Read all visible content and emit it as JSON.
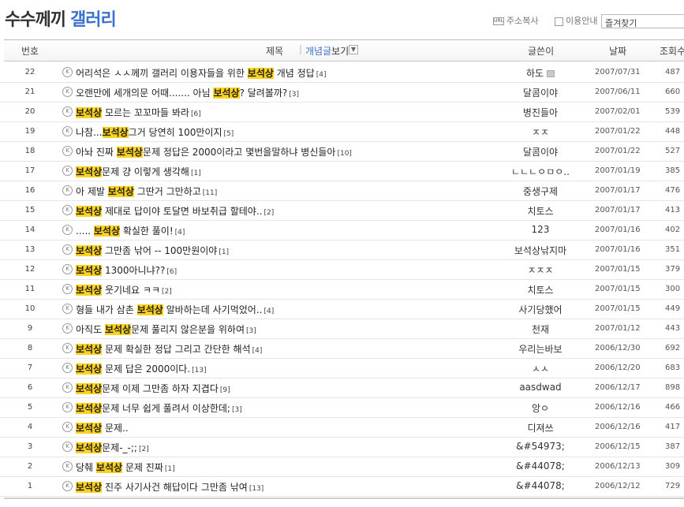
{
  "gallery": {
    "title_part1": "수수께끼",
    "title_part2": "갤러리"
  },
  "tools": {
    "url_icon": "URL",
    "copy_address": "주소복사",
    "usage_guide": "이용안내",
    "favorites": "즐겨찾기"
  },
  "header": {
    "num": "번호",
    "subject": "제목",
    "separator": "|",
    "concept": "개념글",
    "view": "보기",
    "dropdown_icon": "chevron-down-icon",
    "writer": "글쓴이",
    "date": "날짜",
    "hits": "조회수"
  },
  "highlight_color": "#ffd21f",
  "posts": [
    {
      "num": "22",
      "before": "어리석은 ㅅㅅ께끼 갤러리 이용자들을 위한 ",
      "mark": "보석상",
      "after": " 개념 정답",
      "comments": "[4]",
      "writer": "하도",
      "date": "2007/07/31",
      "hits": "487"
    },
    {
      "num": "21",
      "before": "오랜만에 세개의문 어때....... 아님 ",
      "mark": "보석상",
      "after": "? 달려볼까?",
      "comments": "[3]",
      "writer": "달콤이야",
      "date": "2007/06/11",
      "hits": "660"
    },
    {
      "num": "20",
      "before": "",
      "mark": "보석상",
      "after": " 모르는 꼬꼬마들 봐라",
      "comments": "[6]",
      "writer": "병진들아",
      "date": "2007/02/01",
      "hits": "539"
    },
    {
      "num": "19",
      "before": "나참...",
      "mark": "보석상",
      "after": "그거 당연히 100만이지",
      "comments": "[5]",
      "writer": "ㅈㅈ",
      "date": "2007/01/22",
      "hits": "448"
    },
    {
      "num": "18",
      "before": "아놔 진짜 ",
      "mark": "보석상",
      "after": "문제 정답은 2000이라고 몇번을말하냐 병신들아",
      "comments": "[10]",
      "writer": "달콤이야",
      "date": "2007/01/22",
      "hits": "527"
    },
    {
      "num": "17",
      "before": "",
      "mark": "보석상",
      "after": "문제 걍 이렇게 생각해",
      "comments": "[1]",
      "writer": "ㄴㄴㄴㅇㅁㅇ..",
      "date": "2007/01/19",
      "hits": "385"
    },
    {
      "num": "16",
      "before": "아 제발 ",
      "mark": "보석상",
      "after": " 그딴거 그만하고",
      "comments": "[11]",
      "writer": "중생구제",
      "date": "2007/01/17",
      "hits": "476"
    },
    {
      "num": "15",
      "before": "",
      "mark": "보석상",
      "after": " 제대로 답이야 토달면 바보취급 할테야..",
      "comments": "[2]",
      "writer": "치토스",
      "date": "2007/01/17",
      "hits": "413"
    },
    {
      "num": "14",
      "before": "..... ",
      "mark": "보석상",
      "after": " 확실한 풀이!",
      "comments": "[4]",
      "writer": "123",
      "date": "2007/01/16",
      "hits": "402"
    },
    {
      "num": "13",
      "before": "",
      "mark": "보석상",
      "after": " 그만좀 낚어 -- 100만원이야",
      "comments": "[1]",
      "writer": "보석상낚지마",
      "date": "2007/01/16",
      "hits": "351"
    },
    {
      "num": "12",
      "before": "",
      "mark": "보석상",
      "after": " 1300아니냐??",
      "comments": "[6]",
      "writer": "ㅈㅈㅈ",
      "date": "2007/01/15",
      "hits": "379"
    },
    {
      "num": "11",
      "before": "",
      "mark": "보석상",
      "after": " 웃기네요 ㅋㅋ",
      "comments": "[2]",
      "writer": "치토스",
      "date": "2007/01/15",
      "hits": "300"
    },
    {
      "num": "10",
      "before": "형들 내가 삼촌 ",
      "mark": "보석상",
      "after": " 알바하는데 사기먹었어..",
      "comments": "[4]",
      "writer": "사기당했어",
      "date": "2007/01/15",
      "hits": "449"
    },
    {
      "num": "9",
      "before": "아직도 ",
      "mark": "보석상",
      "after": "문제 풀리지 않은분을 위하여",
      "comments": "[3]",
      "writer": "천재",
      "date": "2007/01/12",
      "hits": "443"
    },
    {
      "num": "8",
      "before": "",
      "mark": "보석상",
      "after": " 문제 확실한 정답 그리고 간단한 해석",
      "comments": "[4]",
      "writer": "우리는바보",
      "date": "2006/12/30",
      "hits": "692"
    },
    {
      "num": "7",
      "before": "",
      "mark": "보석상",
      "after": " 문제 답은 2000이다.",
      "comments": "[13]",
      "writer": "ㅅㅅ",
      "date": "2006/12/20",
      "hits": "683"
    },
    {
      "num": "6",
      "before": "",
      "mark": "보석상",
      "after": "문제 이제 그만좀 하자 지겹다",
      "comments": "[9]",
      "writer": "aasdwad",
      "date": "2006/12/17",
      "hits": "898"
    },
    {
      "num": "5",
      "before": "",
      "mark": "보석상",
      "after": "문제 너무 쉽게 풀려서 이상한데;",
      "comments": "[3]",
      "writer": "앙ㅇ",
      "date": "2006/12/16",
      "hits": "466"
    },
    {
      "num": "4",
      "before": "",
      "mark": "보석상",
      "after": " 문제..",
      "comments": "",
      "writer": "디져쓰",
      "date": "2006/12/16",
      "hits": "417"
    },
    {
      "num": "3",
      "before": "",
      "mark": "보석상",
      "after": "문제-_-;;",
      "comments": "[2]",
      "writer": "&#54973;",
      "date": "2006/12/15",
      "hits": "387"
    },
    {
      "num": "2",
      "before": "당췌 ",
      "mark": "보석상",
      "after": " 문제 진짜",
      "comments": "[1]",
      "writer": "&#44078;",
      "date": "2006/12/13",
      "hits": "309"
    },
    {
      "num": "1",
      "before": "",
      "mark": "보석상",
      "after": " 진주 사기사건 해답이다 그만좀 낚여",
      "comments": "[13]",
      "writer": "&#44078;",
      "date": "2006/12/12",
      "hits": "729"
    }
  ]
}
